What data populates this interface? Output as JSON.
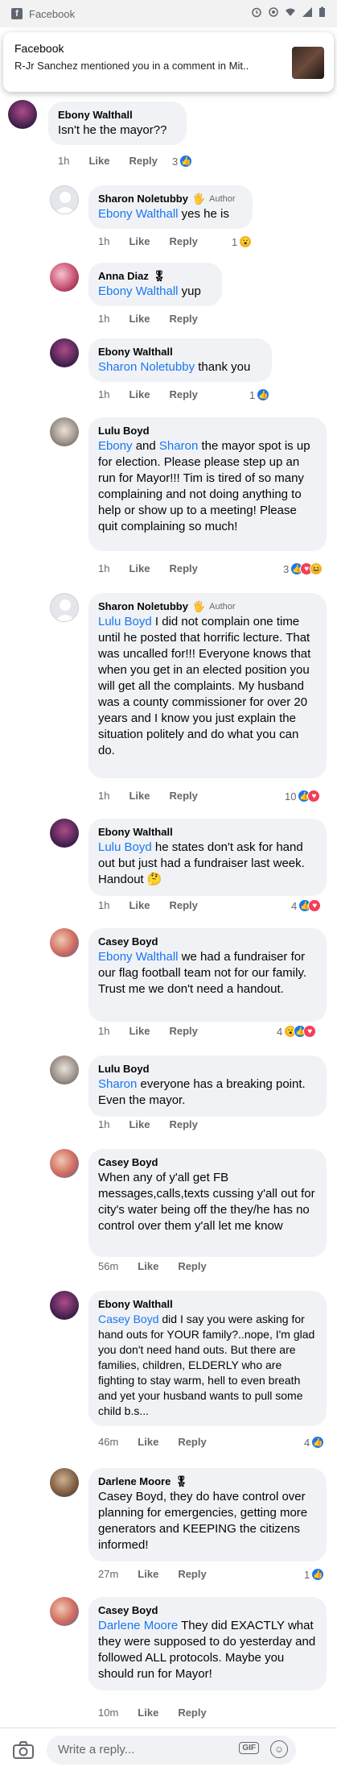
{
  "statusbar": {
    "app_name": "Facebook"
  },
  "notification": {
    "title": "Facebook",
    "body": "R-Jr Sanchez mentioned you in a comment in Mit.."
  },
  "labels": {
    "like": "Like",
    "reply": "Reply",
    "author": "Author"
  },
  "comments": [
    {
      "name": "Ebony Walthall",
      "mention": "",
      "text": "Isn't he the mayor??",
      "time": "1h",
      "reaction_count": "3",
      "reactions": [
        "like"
      ]
    },
    {
      "name": "Sharon Noletubby",
      "mention": "Ebony Walthall",
      "text": " yes he is",
      "time": "1h",
      "reaction_count": "1",
      "reactions": [
        "wow"
      ]
    },
    {
      "name": "Anna Diaz",
      "mention": "Ebony Walthall",
      "text": " yup",
      "time": "1h",
      "reaction_count": "",
      "reactions": []
    },
    {
      "name": "Ebony Walthall",
      "mention": "Sharon Noletubby",
      "text": " thank you",
      "time": "1h",
      "reaction_count": "1",
      "reactions": [
        "like"
      ]
    },
    {
      "name": "Lulu Boyd",
      "mention": "Ebony",
      "mention_mid": " and ",
      "mention2": "Sharon",
      "text": " the mayor spot is up for election. Please please step up an run for Mayor!!! Tim is tired of so many complaining and not doing anything to help or show up to a meeting! Please quit complaining so much!",
      "time": "1h",
      "reaction_count": "3",
      "reactions": [
        "like",
        "love",
        "haha"
      ]
    },
    {
      "name": "Sharon Noletubby",
      "mention": "Lulu Boyd",
      "text": "  I did not complain one time until he posted that horrific lecture. That was uncalled for!!! Everyone knows that when you get in an elected position you will get all the complaints. My husband was a county commissioner for over 20 years and I know you just explain the situation politely and do what you can do.",
      "time": "1h",
      "reaction_count": "10",
      "reactions": [
        "like",
        "love"
      ]
    },
    {
      "name": "Ebony Walthall",
      "mention": "Lulu Boyd",
      "text": " he states don't ask for hand out but just had a fundraiser last week. Handout 🤔",
      "time": "1h",
      "reaction_count": "4",
      "reactions": [
        "like",
        "love"
      ]
    },
    {
      "name": "Casey Boyd",
      "mention": "Ebony Walthall",
      "text": " we had a fundraiser for our flag football team not for our family. Trust me we don't need a handout.",
      "time": "1h",
      "reaction_count": "4",
      "reactions": [
        "wow",
        "like",
        "love"
      ]
    },
    {
      "name": "Lulu Boyd",
      "mention": "Sharon",
      "text": " everyone has a breaking point. Even the mayor.",
      "time": "1h",
      "reaction_count": "",
      "reactions": []
    },
    {
      "name": "Casey Boyd",
      "mention": "",
      "text": "When any of y'all get FB messages,calls,texts  cussing y'all out for city's water being off the they/he has no control over them y'all let me know",
      "time": "56m",
      "reaction_count": "",
      "reactions": []
    },
    {
      "name": "Ebony Walthall",
      "mention": "Casey Boyd",
      "text": " did I say you were asking for hand outs for YOUR family?..nope, I'm glad you don't need hand outs. But there are families, children, ELDERLY who are fighting to stay warm, hell to even breath and yet your husband wants to pull some child b.s...",
      "time": "46m",
      "reaction_count": "4",
      "reactions": [
        "like"
      ]
    },
    {
      "name": "Darlene Moore",
      "mention": "",
      "text": "Casey Boyd, they do have control over planning for emergencies, getting more generators and KEEPING  the citizens informed!",
      "time": "27m",
      "reaction_count": "1",
      "reactions": [
        "like"
      ]
    },
    {
      "name": "Casey Boyd",
      "mention": "Darlene Moore",
      "text": " They did EXACTLY what they were supposed to do yesterday and followed ALL protocols. Maybe you should run for Mayor!",
      "time": "10m",
      "reaction_count": "",
      "reactions": []
    }
  ],
  "reply_bar": {
    "placeholder": "Write a reply...",
    "gif_label": "GIF"
  },
  "colors": {
    "mention": "#1877f2",
    "bubble": "#f0f2f5",
    "like": "#1877f2",
    "love": "#f33e58"
  }
}
